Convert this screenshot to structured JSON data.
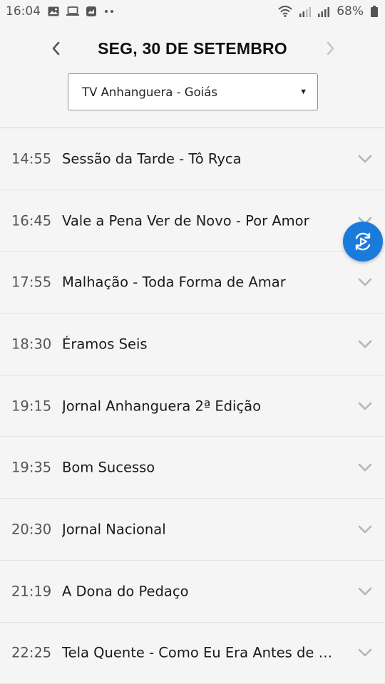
{
  "status_bar": {
    "time": "16:04",
    "left_icons": [
      "image-icon",
      "laptop-icon",
      "media-icon",
      "more-dots-icon"
    ],
    "right_icons": [
      "wifi-icon",
      "signal-icon",
      "signal-icon",
      "battery-icon"
    ],
    "battery": "68%"
  },
  "header": {
    "date": "SEG, 30 DE SETEMBRO",
    "prev_icon": "chevron-left-icon",
    "next_icon": "chevron-right-icon",
    "channel": "TV Anhanguera - Goiás"
  },
  "schedule": [
    {
      "time": "14:55",
      "title": "Sessão da Tarde - Tô Ryca"
    },
    {
      "time": "16:45",
      "title": "Vale a Pena Ver de Novo - Por Amor"
    },
    {
      "time": "17:55",
      "title": "Malhação - Toda Forma de Amar"
    },
    {
      "time": "18:30",
      "title": "Éramos Seis"
    },
    {
      "time": "19:15",
      "title": "Jornal Anhanguera 2ª Edição"
    },
    {
      "time": "19:35",
      "title": "Bom Sucesso"
    },
    {
      "time": "20:30",
      "title": "Jornal Nacional"
    },
    {
      "time": "21:19",
      "title": "A Dona do Pedaço"
    },
    {
      "time": "22:25",
      "title": "Tela Quente - Como Eu Era Antes de Você"
    }
  ],
  "fab": {
    "icon": "replay-play-icon",
    "color": "#1b7bdb"
  },
  "colors": {
    "accent": "#1b7bdb",
    "background": "#f5f5f5"
  }
}
